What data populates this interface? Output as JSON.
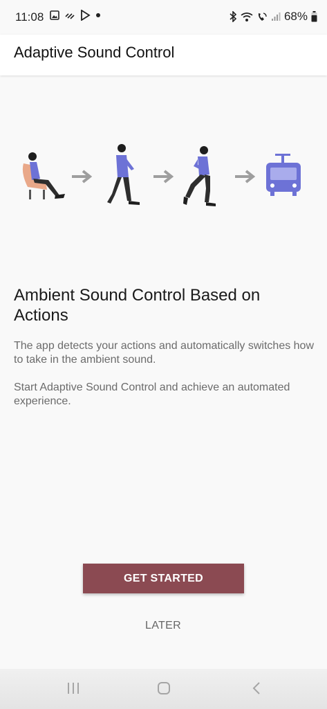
{
  "status_bar": {
    "time": "11:08",
    "battery": "68%",
    "left_icons": [
      "gallery-icon",
      "signal-wave-icon",
      "play-store-icon",
      "notification-dot-icon"
    ],
    "right_icons": [
      "bluetooth-icon",
      "wifi-icon",
      "wifi-call-icon",
      "cell-signal-icon",
      "battery-icon"
    ]
  },
  "app_bar": {
    "title": "Adaptive Sound Control"
  },
  "illustration": {
    "steps": [
      "sitting-person-icon",
      "walking-person-icon",
      "running-person-icon",
      "train-icon"
    ],
    "arrow_color": "#9e9e9e",
    "accent_color": "#6d72d6"
  },
  "content": {
    "heading": "Ambient Sound Control Based on Actions",
    "paragraph1": "The app detects your actions and automatically switches how to take in the ambient sound.",
    "paragraph2": "Start Adaptive Sound Control and achieve an automated experience."
  },
  "actions": {
    "primary_label": "GET STARTED",
    "primary_color": "#8b4a52",
    "secondary_label": "LATER"
  },
  "nav_bar": {
    "buttons": [
      "recents-icon",
      "home-icon",
      "back-icon"
    ]
  }
}
